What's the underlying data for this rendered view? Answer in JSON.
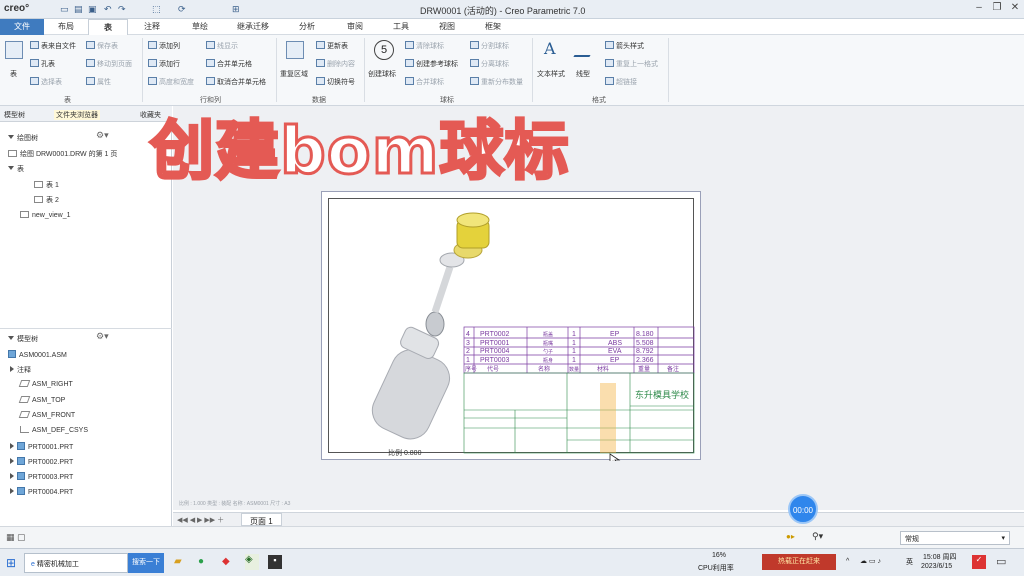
{
  "titlebar": {
    "logo": "creo°",
    "title": "DRW0001 (活动的) - Creo Parametric 7.0"
  },
  "tabs": [
    "文件",
    "布局",
    "表",
    "注释",
    "草绘",
    "继承迁移",
    "分析",
    "审阅",
    "工具",
    "视图",
    "框架"
  ],
  "ribbon": {
    "table_group": {
      "big": "表",
      "items": [
        "表来自文件",
        "保存表",
        "孔表",
        "移动到页面",
        "选择表",
        "属性"
      ],
      "label": "表"
    },
    "rowcol_group": {
      "items": [
        "添加列",
        "添加行",
        "高度和宽度",
        "线显示",
        "合并单元格",
        "取消合并单元格"
      ],
      "label": "行和列"
    },
    "data_group": {
      "big": "重复区域",
      "items": [
        "更新表",
        "删除内容",
        "切换符号"
      ],
      "label": "数据"
    },
    "balloon_group": {
      "big": "创建球标",
      "items": [
        "清除球标",
        "创建参考球标",
        "合并球标",
        "分割球标",
        "分离球标",
        "重新分布数量"
      ],
      "label": "球标"
    },
    "format_group": {
      "big1": "文本样式",
      "big2": "线型",
      "items": [
        "箭头样式",
        "重复上一格式",
        "超链接"
      ],
      "label": "格式"
    }
  },
  "sidebar": {
    "tabs": [
      "模型树",
      "文件夹浏览器",
      "收藏夹"
    ],
    "drawing_tree": {
      "header": "绘图树",
      "items": [
        "绘图 DRW0001.DRW 的第 1 页",
        "表",
        "表 1",
        "表 2",
        "new_view_1"
      ]
    },
    "model_tree": {
      "header": "模型树",
      "items": [
        "ASM0001.ASM",
        "注释",
        "ASM_RIGHT",
        "ASM_TOP",
        "ASM_FRONT",
        "ASM_DEF_CSYS",
        "PRT0001.PRT",
        "PRT0002.PRT",
        "PRT0003.PRT",
        "PRT0004.PRT"
      ]
    }
  },
  "overlay_text": "创建bom球标",
  "bom": {
    "rows": [
      {
        "idx": "4",
        "code": "PRT0002",
        "name": "瓶盖",
        "qty": "1",
        "mat": "EP",
        "wt": "8.180"
      },
      {
        "idx": "3",
        "code": "PRT0001",
        "name": "瓶嘴",
        "qty": "1",
        "mat": "ABS",
        "wt": "5.508"
      },
      {
        "idx": "2",
        "code": "PRT0004",
        "name": "勺子",
        "qty": "1",
        "mat": "EVA",
        "wt": "8.792"
      },
      {
        "idx": "1",
        "code": "PRT0003",
        "name": "瓶身",
        "qty": "1",
        "mat": "EP",
        "wt": "2.366"
      }
    ],
    "header": [
      "序号",
      "代号",
      "名称",
      "数量",
      "材料",
      "重量",
      "备注"
    ],
    "school": "东升模具学校",
    "view_label": "比例 0.800"
  },
  "status_line": "比例 : 1.000    类型 : 装配    名称 : ASM0001    尺寸 : A3",
  "pagebar": {
    "page": "页面 1"
  },
  "timer": "00:00",
  "lowerbar": {
    "filter": "常规"
  },
  "taskbar": {
    "app": "精密机械加工",
    "search": "搜索一下",
    "cpu": "16%",
    "cpu_label": "CPU利用率",
    "ime": "英",
    "time": "15:08 周四",
    "date": "2023/6/15",
    "promo": "热载正在赶来"
  }
}
